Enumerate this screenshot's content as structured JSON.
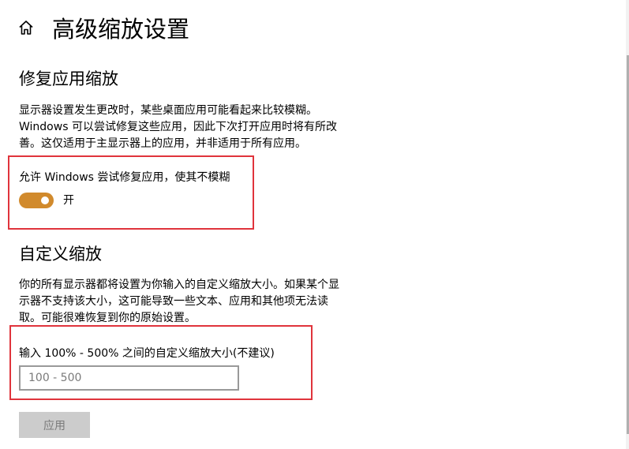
{
  "header": {
    "title": "高级缩放设置",
    "home_icon": "home-icon"
  },
  "fix_apps": {
    "title": "修复应用缩放",
    "description_lines": [
      "显示器设置发生更改时，某些桌面应用可能看起来比较模糊。",
      "Windows 可以尝试修复这些应用，因此下次打开应用时将有所改",
      "善。这仅适用于主显示器上的应用，并非适用于所有应用。"
    ],
    "toggle_label": "允许 Windows 尝试修复应用，使其不模糊",
    "toggle_state": "开",
    "toggle_on": true
  },
  "custom_scaling": {
    "title": "自定义缩放",
    "description_lines": [
      "你的所有显示器都将设置为你输入的自定义缩放大小。如果某个显",
      "示器不支持该大小，这可能导致一些文本、应用和其他项无法读",
      "取。可能很难恢复到你的原始设置。"
    ],
    "input_label": "输入 100% - 500% 之间的自定义缩放大小(不建议)",
    "input_placeholder": "100 - 500",
    "input_value": "",
    "apply_label": "应用"
  },
  "colors": {
    "accent": "#d18a2c",
    "highlight_border": "#e0343c",
    "disabled_button": "#cccccc"
  }
}
